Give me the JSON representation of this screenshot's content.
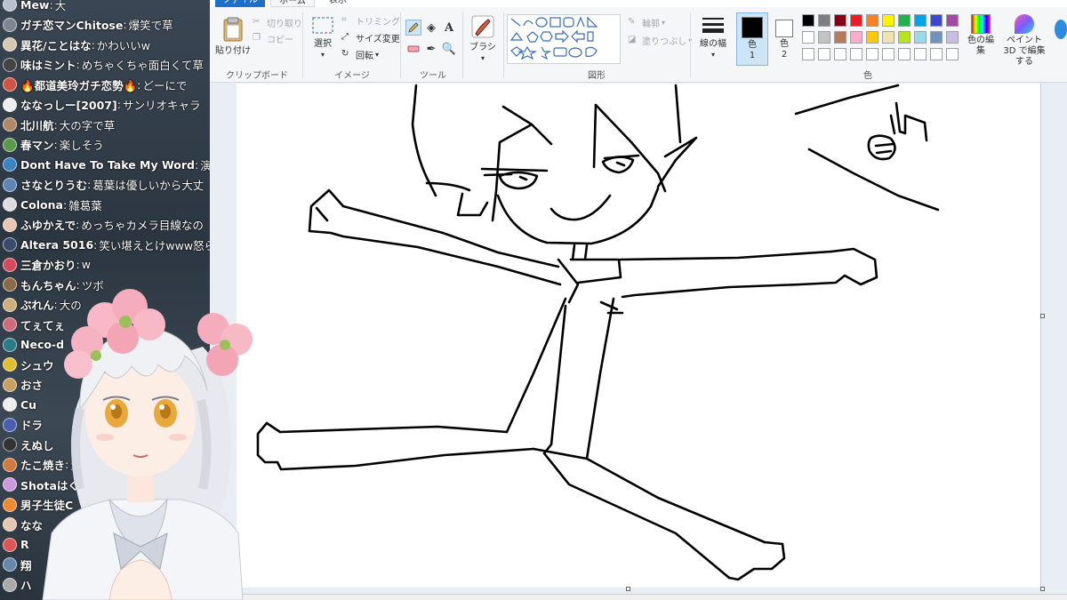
{
  "chat": {
    "messages": [
      {
        "name": "Mew",
        "text": "大",
        "color": "#b9c2cc"
      },
      {
        "name": "ガチ恋マンChitose",
        "text": "爆笑で草",
        "color": "#7c8791"
      },
      {
        "name": "異花/ことはな",
        "text": "かわいいw",
        "color": "#d8c7b0"
      },
      {
        "name": "味はミント",
        "text": "めちゃくちゃ面白くて草",
        "color": "#444"
      },
      {
        "name": "🔥都道美玲ガチ恋勢🔥",
        "text": "どーにで",
        "color": "#cc5544"
      },
      {
        "name": "ななっしー[2007]",
        "text": "サンリオキャラ",
        "color": "#eeeeee"
      },
      {
        "name": "北川航",
        "text": "大の字で草",
        "color": "#b08a66"
      },
      {
        "name": "春マン",
        "text": "楽しそう",
        "color": "#5a9a4a"
      },
      {
        "name": "Dont Have To Take My Word",
        "text": "演劇",
        "color": "#3b84c4"
      },
      {
        "name": "さなとりうむ",
        "text": "葛葉は優しいから大丈",
        "color": "#5d86b4"
      },
      {
        "name": "Colona",
        "text": "雑葛葉",
        "color": "#ddd"
      },
      {
        "name": "ふゆかえで",
        "text": "めっちゃカメラ目線なの",
        "color": "#e9c7b3"
      },
      {
        "name": "Altera 5016",
        "text": "笑い堪えとけwww怒ら",
        "color": "#3a4a6a"
      },
      {
        "name": "三倉かおり",
        "text": "w",
        "color": "#d54a5a"
      },
      {
        "name": "もんちゃん",
        "text": "ツボ",
        "color": "#8b6a4a"
      },
      {
        "name": "ぶれん",
        "text": "大の",
        "color": "#d0b07a"
      },
      {
        "name": "てぇてぇ",
        "text": "",
        "color": "#d06a7a"
      },
      {
        "name": "Neco-d",
        "text": "",
        "color": "#2d7a8a"
      },
      {
        "name": "シュウ",
        "text": "",
        "color": "#e0c030"
      },
      {
        "name": "おさ",
        "text": "",
        "color": "#caa060"
      },
      {
        "name": "Cu",
        "text": "",
        "color": "#eee"
      },
      {
        "name": "ドラ",
        "text": "",
        "color": "#4b5fb0"
      },
      {
        "name": "えぬし",
        "text": "",
        "color": "#333"
      },
      {
        "name": "たこ焼き",
        "text": "素",
        "color": "#d07a40"
      },
      {
        "name": "Shotaはぐれ",
        "text": "",
        "color": "#cc99dd"
      },
      {
        "name": "男子生徒C",
        "text": "",
        "color": "#ee8833"
      },
      {
        "name": "なな",
        "text": "",
        "color": "#e6c8b0"
      },
      {
        "name": "R",
        "text": "",
        "color": "#d55"
      },
      {
        "name": "翔",
        "text": "",
        "color": "#6688aa"
      },
      {
        "name": "ハ",
        "text": "",
        "color": "#aaa"
      }
    ]
  },
  "ribbon": {
    "tabs": {
      "file": "ファイル",
      "home": "ホーム",
      "view": "表示"
    },
    "clipboard": {
      "label": "クリップボード",
      "paste": "貼り付け",
      "cut": "切り取り",
      "copy": "コピー"
    },
    "image": {
      "label": "イメージ",
      "select": "選択",
      "crop": "トリミング",
      "resize": "サイズ変更",
      "rotate": "回転"
    },
    "tools": {
      "label": "ツール"
    },
    "brushes": {
      "label": "ブラシ"
    },
    "shapes": {
      "label": "図形",
      "outline": "輪郭",
      "fill": "塗りつぶし"
    },
    "size": {
      "label": "線の幅"
    },
    "colors": {
      "label": "色",
      "color1": "色",
      "color1_num": "1",
      "color2": "色",
      "color2_num": "2",
      "edit": "色の編集",
      "paint3d": "ペイント 3D で編集する",
      "palette": [
        "#000000",
        "#7f7f7f",
        "#880015",
        "#ed1c24",
        "#ff7f27",
        "#fff200",
        "#22b14c",
        "#00a2e8",
        "#3f48cc",
        "#a349a4",
        "#ffffff",
        "#c3c3c3",
        "#b97a57",
        "#ffaec9",
        "#ffc90e",
        "#efe4b0",
        "#b5e61d",
        "#99d9ea",
        "#7092be",
        "#c8bfe7"
      ]
    }
  }
}
